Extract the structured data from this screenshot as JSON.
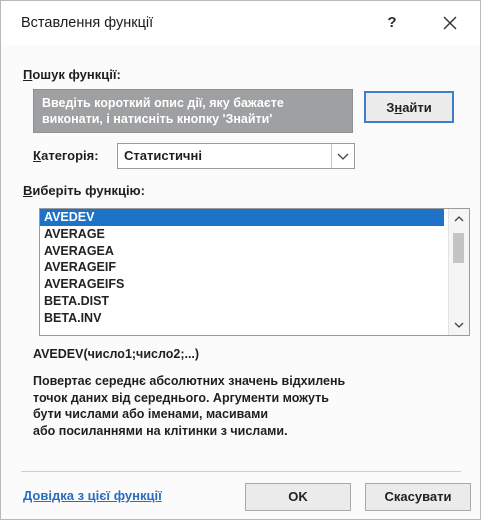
{
  "dialog": {
    "title": "Вставлення функції",
    "help_symbol": "?"
  },
  "search": {
    "label_accel": "П",
    "label_rest": "ошук функції:",
    "description_line1": "Введіть короткий опис дії, яку бажаєте",
    "description_line2": "виконати, і натисніть кнопку 'Знайти'",
    "find_button_pre": "З",
    "find_button_accel": "н",
    "find_button_post": "айти"
  },
  "category": {
    "label_accel": "К",
    "label_rest": "атегорія:",
    "selected": "Статистичні"
  },
  "function_list": {
    "label_accel": "В",
    "label_rest": "иберіть функцію:",
    "items": [
      "AVEDEV",
      "AVERAGE",
      "AVERAGEA",
      "AVERAGEIF",
      "AVERAGEIFS",
      "BETA.DIST",
      "BETA.INV"
    ],
    "selected_index": 0
  },
  "details": {
    "signature": "AVEDEV(число1;число2;...)",
    "description_lines": [
      "Повертає середнє абсолютних значень відхилень",
      "точок даних від середнього. Аргументи можуть",
      "бути числами або іменами, масивами",
      "або посиланнями на клітинки з числами."
    ]
  },
  "footer": {
    "help_link": "Довідка з цієї функції",
    "ok_label": "OK",
    "cancel_label": "Скасувати"
  },
  "colors": {
    "selection": "#1e73c8",
    "link": "#2a6cbf",
    "search_box": "#9fa0a2",
    "focus_border": "#3f7ec9"
  }
}
